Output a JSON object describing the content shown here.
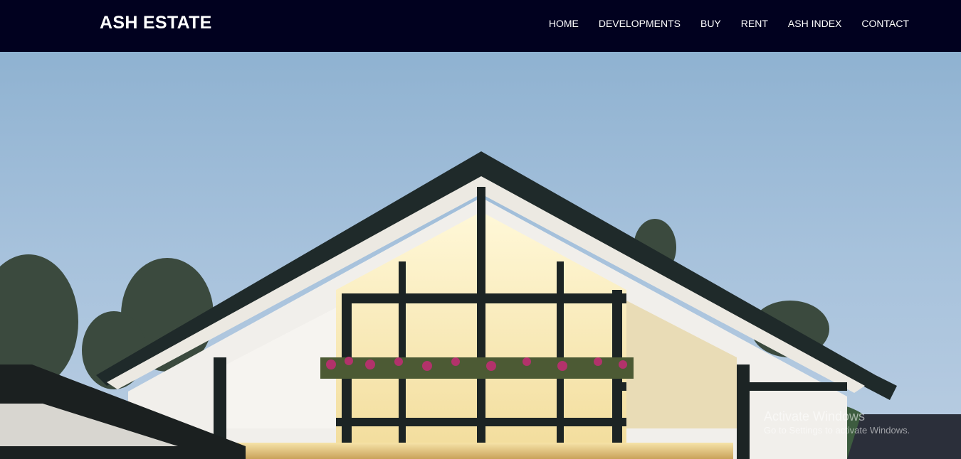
{
  "brand": {
    "name": "ASH ESTATE"
  },
  "nav": {
    "items": [
      {
        "label": "HOME"
      },
      {
        "label": "DEVELOPMENTS"
      },
      {
        "label": "BUY"
      },
      {
        "label": "RENT"
      },
      {
        "label": "ASH INDEX"
      },
      {
        "label": "CONTACT"
      }
    ]
  },
  "colors": {
    "navbar": "#01011f",
    "nav_text": "#ffffff",
    "sky": "#a9c3dc"
  },
  "watermark": {
    "title": "Activate Windows",
    "subtitle": "Go to Settings to activate Windows."
  }
}
